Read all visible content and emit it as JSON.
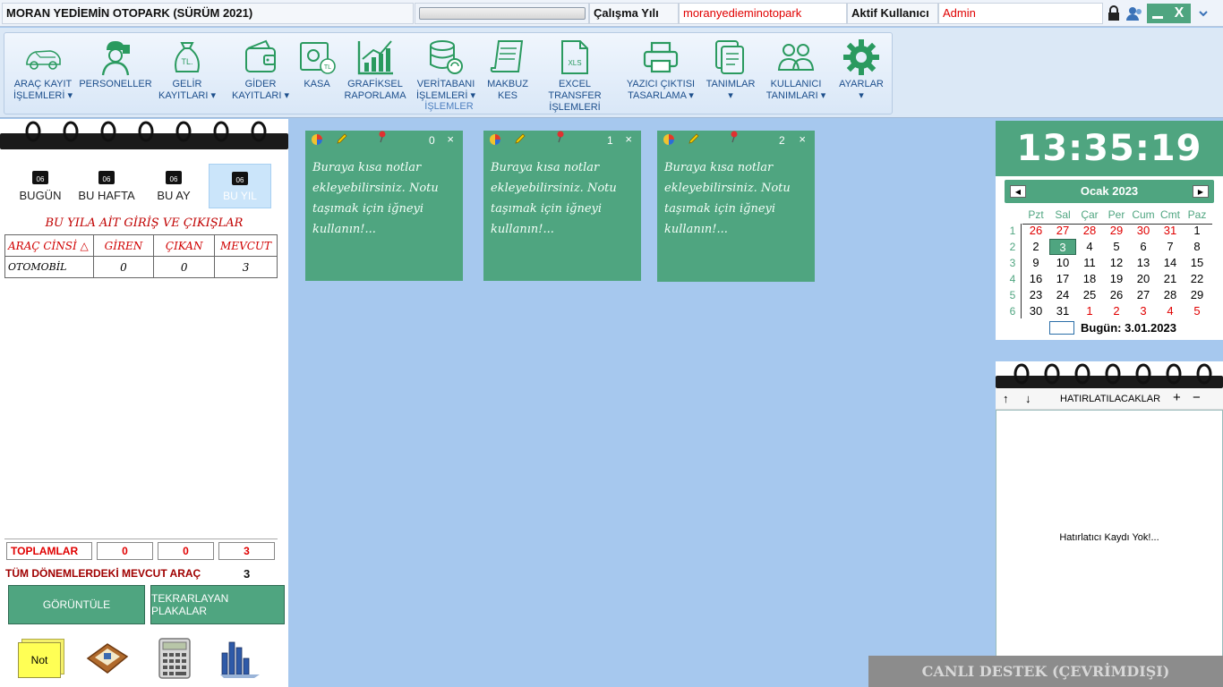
{
  "titlebar": {
    "app_title": "MORAN YEDİEMİN OTOPARK (SÜRÜM 2021)",
    "year_label": "Çalışma Yılı",
    "year_value": "moranyedieminotopark",
    "user_label": "Aktif Kullanıcı",
    "user_value": "Admin",
    "close_glyph": "X"
  },
  "ribbon": {
    "group_label": "İŞLEMLER",
    "items": [
      {
        "label": "ARAÇ KAYIT\nİŞLEMLERİ ▾",
        "icon": "car-icon"
      },
      {
        "label": "PERSONELLER",
        "icon": "staff-icon"
      },
      {
        "label": "GELİR\nKAYITLARI ▾",
        "icon": "income-bag-icon"
      },
      {
        "label": "GİDER\nKAYITLARI ▾",
        "icon": "wallet-icon"
      },
      {
        "label": "KASA",
        "icon": "safe-icon"
      },
      {
        "label": "GRAFİKSEL\nRAPORLAMA",
        "icon": "chart-icon"
      },
      {
        "label": "VERİTABANI\nİŞLEMLERİ ▾",
        "icon": "database-icon"
      },
      {
        "label": "MAKBUZ\nKES",
        "icon": "receipt-icon"
      },
      {
        "label": "EXCEL TRANSFER\nİŞLEMLERİ",
        "icon": "excel-file-icon"
      },
      {
        "label": "YAZICI ÇIKTISI\nTASARLAMA ▾",
        "icon": "printer-icon"
      },
      {
        "label": "TANIMLAR\n▾",
        "icon": "documents-icon"
      },
      {
        "label": "KULLANICI\nTANIMLARI ▾",
        "icon": "users-icon"
      },
      {
        "label": "AYARLAR\n▾",
        "icon": "gear-icon"
      }
    ],
    "excel_badge": "XLS",
    "income_badge": "TL.",
    "safe_badge": "TL"
  },
  "left": {
    "period_buttons": [
      {
        "label": "BUGÜN",
        "badge": "06"
      },
      {
        "label": "BU HAFTA",
        "badge": "06"
      },
      {
        "label": "BU AY",
        "badge": "06"
      },
      {
        "label": "BU YIL",
        "badge": "06"
      }
    ],
    "heading": "BU YILA AİT GİRİŞ VE ÇIKIŞLAR",
    "table": {
      "headers": [
        "ARAÇ CİNSİ △",
        "GİREN",
        "ÇIKAN",
        "MEVCUT"
      ],
      "rows": [
        [
          "OTOMOBİL",
          "0",
          "0",
          "3"
        ]
      ]
    },
    "totals": {
      "label": "TOPLAMLAR",
      "values": [
        "0",
        "0",
        "3"
      ]
    },
    "all_periods_label": "TÜM DÖNEMLERDEKİ MEVCUT ARAÇ",
    "all_periods_value": "3",
    "view_button": "GÖRÜNTÜLE",
    "repeating_button": "TEKRARLAYAN PLAKALAR",
    "note_button": "Not"
  },
  "notes": [
    {
      "index": "0",
      "text": "Buraya kısa notlar ekleyebilirsiniz. Notu taşımak için iğneyi kullanın!..."
    },
    {
      "index": "1",
      "text": "Buraya kısa notlar ekleyebilirsiniz. Notu taşımak için iğneyi kullanın!..."
    },
    {
      "index": "2",
      "text": "Buraya kısa notlar ekleyebilirsiniz. Notu taşımak için iğneyi kullanın!..."
    }
  ],
  "note_close_glyph": "×",
  "clock": "13:35:19",
  "calendar": {
    "title": "Ocak 2023",
    "weekdays": [
      "Pzt",
      "Sal",
      "Çar",
      "Per",
      "Cum",
      "Cmt",
      "Paz"
    ],
    "weeks": [
      "1",
      "2",
      "3",
      "4",
      "5",
      "6"
    ],
    "days": [
      [
        "26",
        "27",
        "28",
        "29",
        "30",
        "31",
        "1"
      ],
      [
        "2",
        "3",
        "4",
        "5",
        "6",
        "7",
        "8"
      ],
      [
        "9",
        "10",
        "11",
        "12",
        "13",
        "14",
        "15"
      ],
      [
        "16",
        "17",
        "18",
        "19",
        "20",
        "21",
        "22"
      ],
      [
        "23",
        "24",
        "25",
        "26",
        "27",
        "28",
        "29"
      ],
      [
        "30",
        "31",
        "1",
        "2",
        "3",
        "4",
        "5"
      ]
    ],
    "today_label": "Bugün: 3.01.2023"
  },
  "reminders": {
    "title": "HATIRLATILACAKLAR",
    "empty_text": "Hatırlatıcı Kaydı Yok!...",
    "up_glyph": "↑",
    "down_glyph": "↓",
    "add_glyph": "+",
    "remove_glyph": "−"
  },
  "live_support": "CANLI DESTEK (ÇEVRİMDIŞI)",
  "colors": {
    "accent_green": "#4fa580",
    "background_blue": "#a6c8ee",
    "red": "#e00000"
  }
}
